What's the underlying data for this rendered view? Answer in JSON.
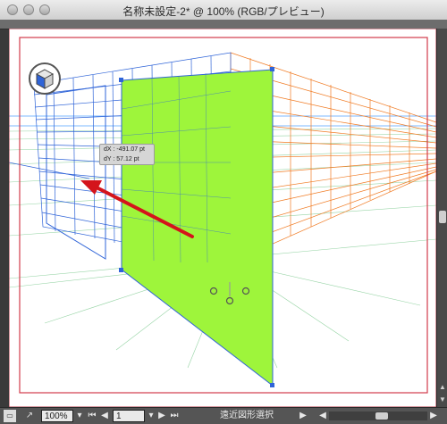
{
  "window": {
    "title": "名称未設定-2* @ 100% (RGB/プレビュー)"
  },
  "tooltip": {
    "dx": "dX : -491.07 pt",
    "dy": "dY : 57.12 pt"
  },
  "status": {
    "zoom": "100%",
    "artboard": "1",
    "tool": "遠近図形選択"
  },
  "colors": {
    "left_grid": "#2f64d8",
    "right_grid": "#f07a22",
    "ground_grid": "#2aa84a",
    "plane_fill": "#9ef53b",
    "arrow": "#d4141b",
    "artboard_border": "#d23b4b"
  },
  "icons": {
    "plane_widget": "perspective-cube-icon",
    "close": "close-button-icon",
    "minimize": "minimize-button-icon",
    "zoom": "zoom-button-icon"
  }
}
